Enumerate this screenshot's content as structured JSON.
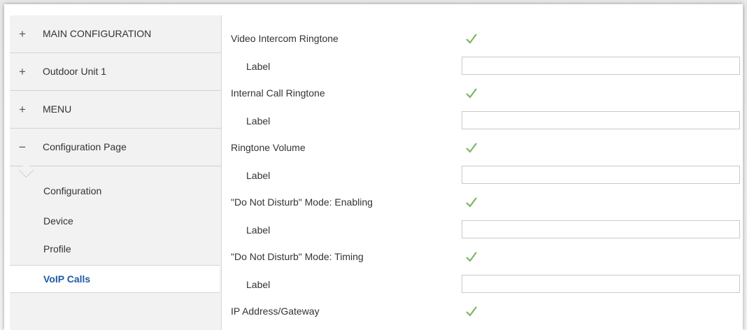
{
  "sidebar": {
    "sections": [
      {
        "sign": "+",
        "label": "MAIN CONFIGURATION"
      },
      {
        "sign": "+",
        "label": "Outdoor Unit 1"
      },
      {
        "sign": "+",
        "label": "MENU"
      },
      {
        "sign": "−",
        "label": "Configuration Page"
      }
    ],
    "subitems": [
      {
        "label": "Configuration"
      },
      {
        "label": "Device"
      },
      {
        "label": "Profile"
      },
      {
        "label": "VoIP Calls",
        "active": true
      }
    ]
  },
  "params": [
    {
      "label": "Video Intercom Ringtone",
      "checked": true,
      "sub_label": "Label",
      "sub_value": ""
    },
    {
      "label": "Internal Call Ringtone",
      "checked": true,
      "sub_label": "Label",
      "sub_value": ""
    },
    {
      "label": "Ringtone Volume",
      "checked": true,
      "sub_label": "Label",
      "sub_value": ""
    },
    {
      "label": "\"Do Not Disturb\" Mode: Enabling",
      "checked": true,
      "sub_label": "Label",
      "sub_value": ""
    },
    {
      "label": "\"Do Not Disturb\" Mode: Timing",
      "checked": true,
      "sub_label": "Label",
      "sub_value": ""
    },
    {
      "label": "IP Address/Gateway",
      "checked": true
    }
  ],
  "colors": {
    "check": "#7bb661",
    "active_text": "#1f5aa6",
    "sidebar_bg": "#f2f2f2"
  },
  "icons": {
    "check": "checkmark-icon",
    "expand": "plus-icon",
    "collapse": "minus-icon"
  }
}
